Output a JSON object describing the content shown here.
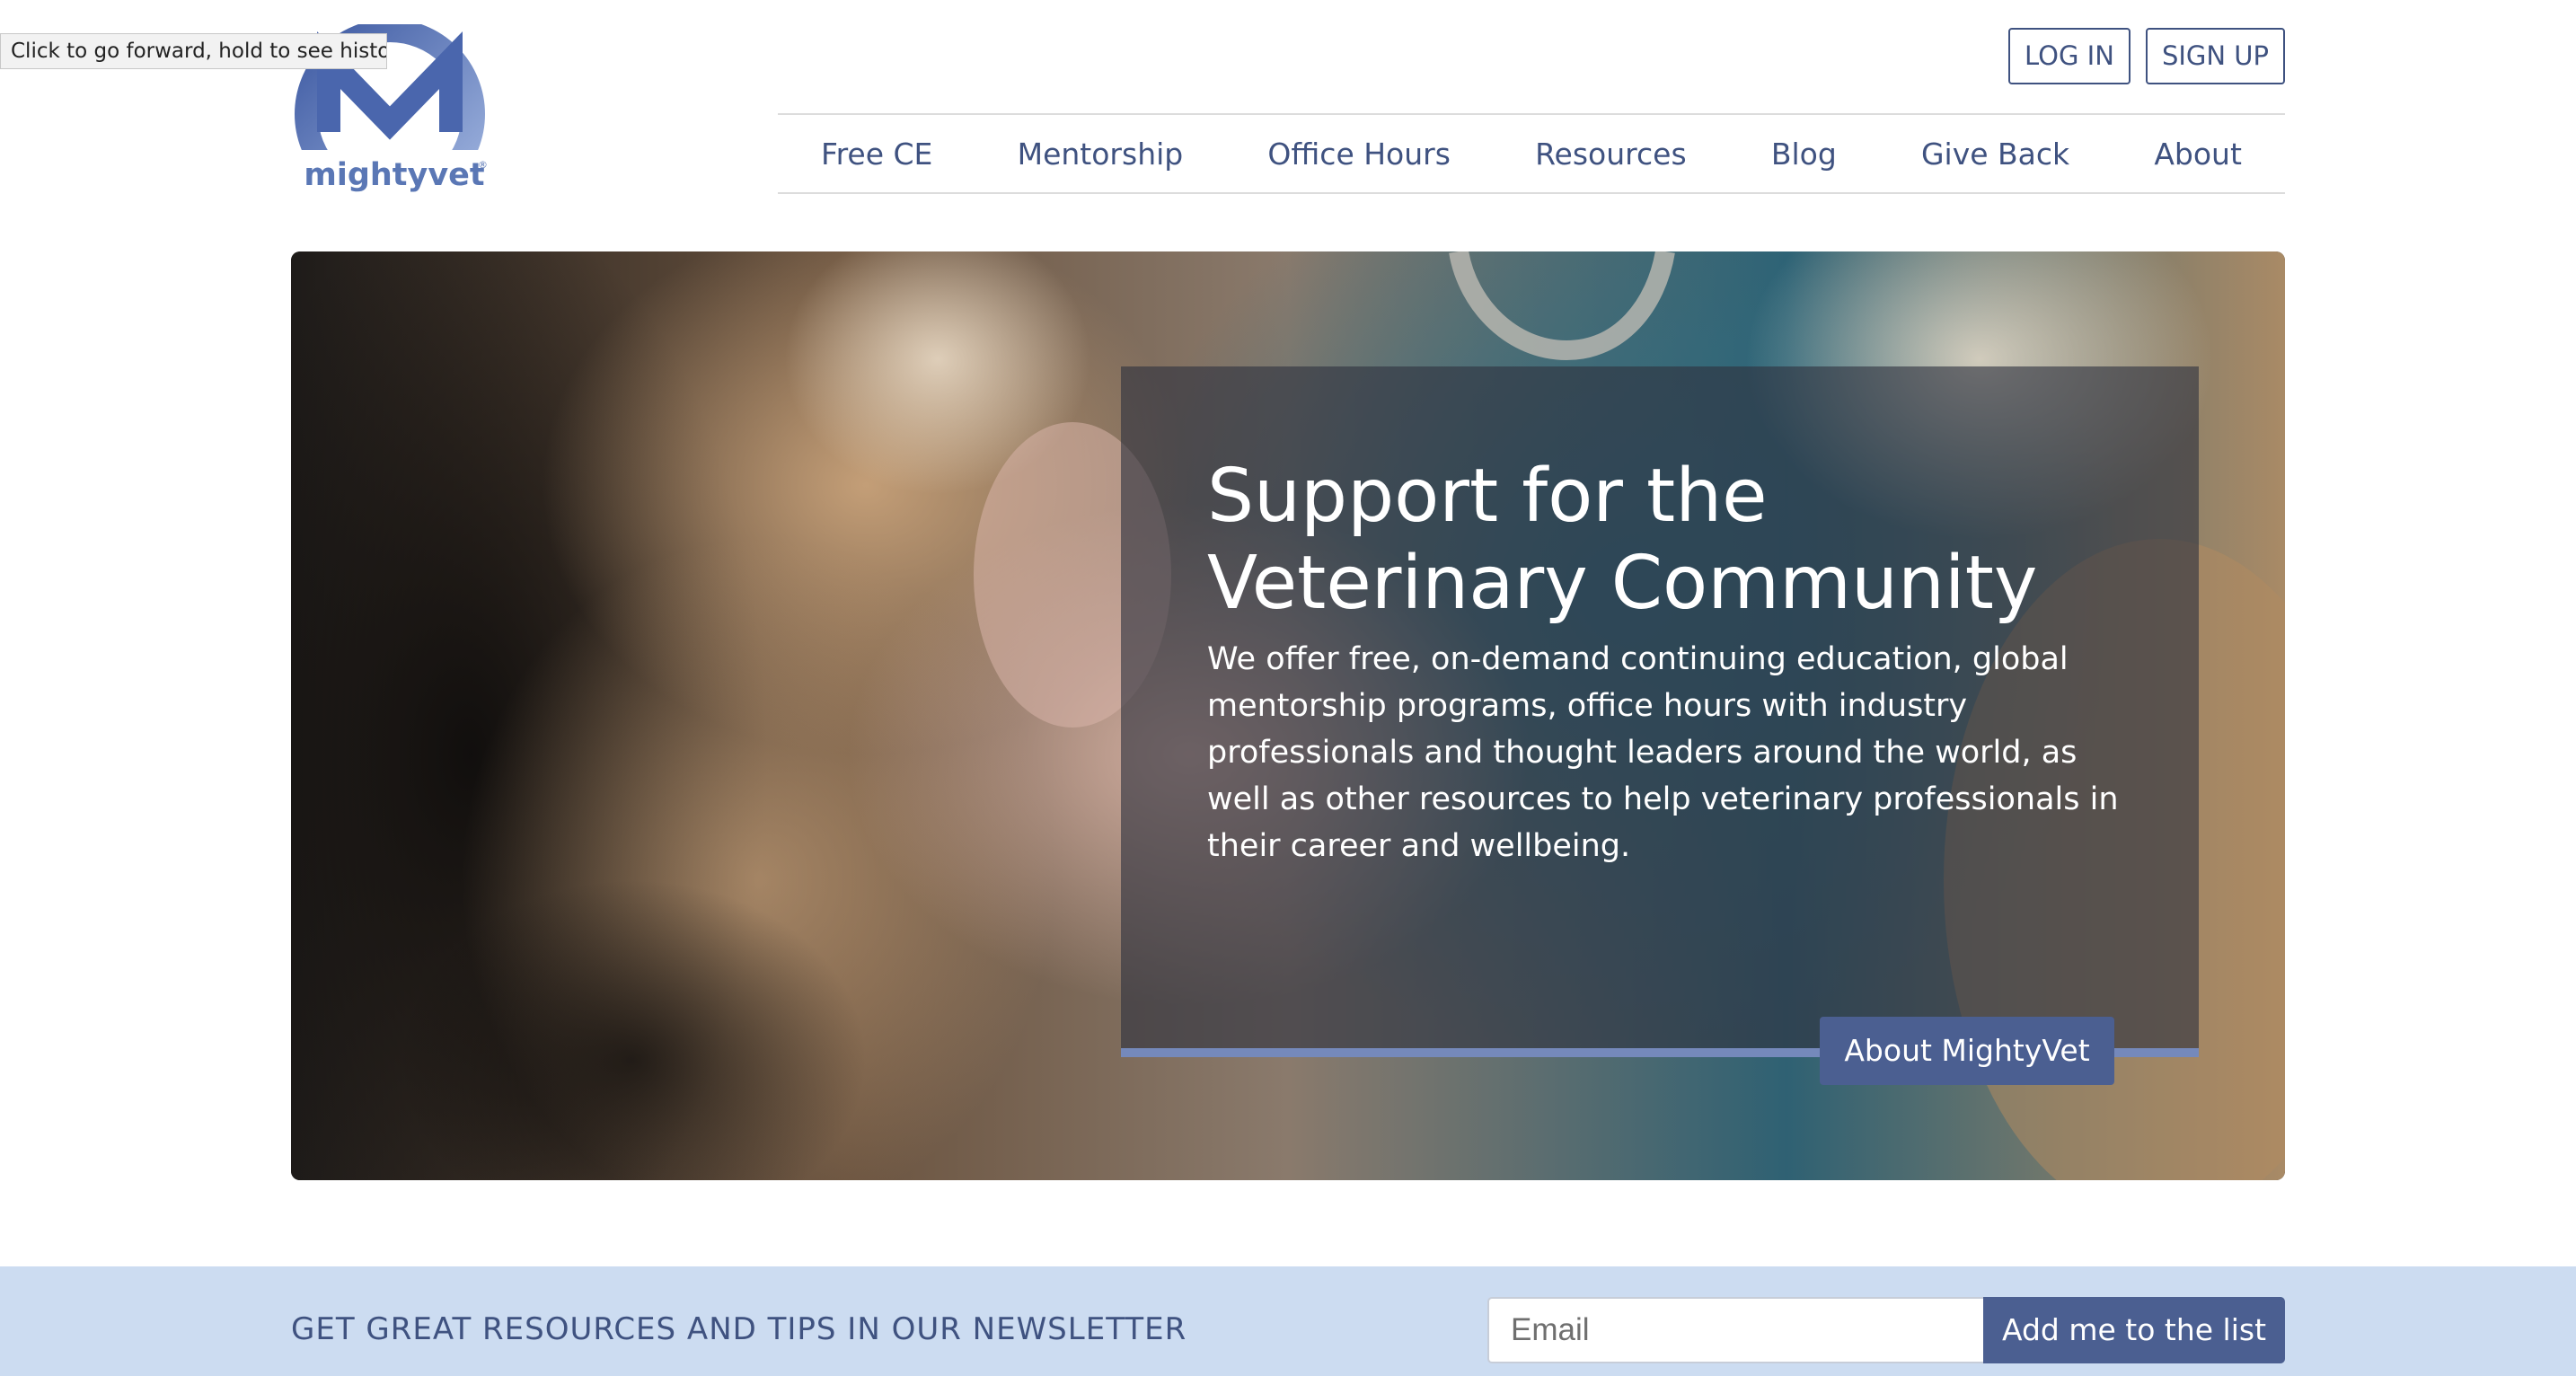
{
  "tooltip": {
    "text": "Click to go forward, hold to see history"
  },
  "logo": {
    "text": "mightyvet",
    "reg_mark": "®",
    "color": "#5a77b5"
  },
  "auth": {
    "login_label": "LOG IN",
    "signup_label": "SIGN UP"
  },
  "nav": {
    "items": [
      {
        "label": "Free CE"
      },
      {
        "label": "Mentorship"
      },
      {
        "label": "Office Hours"
      },
      {
        "label": "Resources"
      },
      {
        "label": "Blog"
      },
      {
        "label": "Give Back"
      },
      {
        "label": "About"
      }
    ]
  },
  "hero": {
    "title_line1": "Support for the",
    "title_line2": "Veterinary Community",
    "body": "We offer free, on-demand continuing education, global mentorship programs, office hours with industry professionals and thought leaders around the world, as well as other resources to help veterinary professionals in their career and wellbeing.",
    "button_label": "About MightyVet",
    "image": "dog-paw-in-hand-photo"
  },
  "newsletter": {
    "label": "GET GREAT RESOURCES AND TIPS IN OUR NEWSLETTER",
    "email_placeholder": "Email",
    "submit_label": "Add me to the list"
  },
  "colors": {
    "brand_navy": "#3f5280",
    "button_blue": "#4b5f91",
    "accent_bar": "#7589bb",
    "newsletter_bg": "#ccdcf1"
  }
}
